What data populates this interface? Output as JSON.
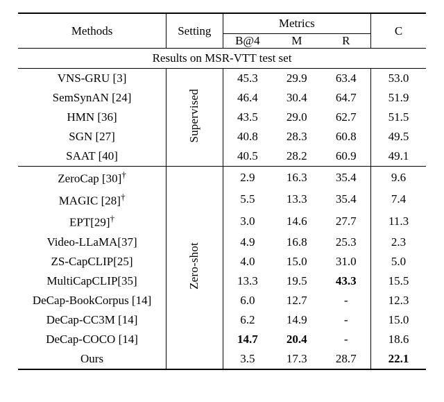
{
  "header": {
    "methods": "Methods",
    "setting": "Setting",
    "metrics_group": "Metrics",
    "m_b4": "B@4",
    "m_m": "M",
    "m_r": "R",
    "m_c": "C"
  },
  "section_title": "Results on MSR-VTT test set",
  "groups": [
    {
      "setting_label": "Supervised"
    },
    {
      "setting_label": "Zero-shot"
    }
  ],
  "rows_supervised": [
    {
      "method": "VNS-GRU [3]",
      "b4": "45.3",
      "m": "29.9",
      "r": "63.4",
      "c": "53.0"
    },
    {
      "method": "SemSynAN [24]",
      "b4": "46.4",
      "m": "30.4",
      "r": "64.7",
      "c": "51.9"
    },
    {
      "method": "HMN [36]",
      "b4": "43.5",
      "m": "29.0",
      "r": "62.7",
      "c": "51.5"
    },
    {
      "method": "SGN [27]",
      "b4": "40.8",
      "m": "28.3",
      "r": "60.8",
      "c": "49.5"
    },
    {
      "method": "SAAT [40]",
      "b4": "40.5",
      "m": "28.2",
      "r": "60.9",
      "c": "49.1"
    }
  ],
  "rows_zeroshot": [
    {
      "method": "ZeroCap [30]†",
      "b4": "2.9",
      "m": "16.3",
      "r": "35.4",
      "c": "9.6"
    },
    {
      "method": "MAGIC [28]†",
      "b4": "5.5",
      "m": "13.3",
      "r": "35.4",
      "c": "7.4"
    },
    {
      "method": "EPT[29]†",
      "b4": "3.0",
      "m": "14.6",
      "r": "27.7",
      "c": "11.3"
    },
    {
      "method": "Video-LLaMA[37]",
      "b4": "4.9",
      "m": "16.8",
      "r": "25.3",
      "c": "2.3"
    },
    {
      "method": "ZS-CapCLIP[25]",
      "b4": "4.0",
      "m": "15.0",
      "r": "31.0",
      "c": "5.0"
    },
    {
      "method": "MultiCapCLIP[35]",
      "b4": "13.3",
      "m": "19.5",
      "r": "43.3",
      "r_bold": true,
      "c": "15.5"
    },
    {
      "method": "DeCap-BookCorpus [14]",
      "b4": "6.0",
      "m": "12.7",
      "r": "-",
      "c": "12.3"
    },
    {
      "method": "DeCap-CC3M [14]",
      "b4": "6.2",
      "m": "14.9",
      "r": "-",
      "c": "15.0"
    },
    {
      "method": "DeCap-COCO [14]",
      "b4": "14.7",
      "b4_bold": true,
      "m": "20.4",
      "m_bold": true,
      "r": "-",
      "c": "18.6"
    },
    {
      "method": "Ours",
      "b4": "3.5",
      "m": "17.3",
      "r": "28.7",
      "c": "22.1",
      "c_bold": true
    }
  ],
  "chart_data": {
    "type": "table",
    "title": "Results on MSR-VTT test set",
    "columns": [
      "Methods",
      "Setting",
      "B@4",
      "M",
      "R",
      "C"
    ],
    "rows": [
      [
        "VNS-GRU [3]",
        "Supervised",
        45.3,
        29.9,
        63.4,
        53.0
      ],
      [
        "SemSynAN [24]",
        "Supervised",
        46.4,
        30.4,
        64.7,
        51.9
      ],
      [
        "HMN [36]",
        "Supervised",
        43.5,
        29.0,
        62.7,
        51.5
      ],
      [
        "SGN [27]",
        "Supervised",
        40.8,
        28.3,
        60.8,
        49.5
      ],
      [
        "SAAT [40]",
        "Supervised",
        40.5,
        28.2,
        60.9,
        49.1
      ],
      [
        "ZeroCap [30]†",
        "Zero-shot",
        2.9,
        16.3,
        35.4,
        9.6
      ],
      [
        "MAGIC [28]†",
        "Zero-shot",
        5.5,
        13.3,
        35.4,
        7.4
      ],
      [
        "EPT[29]†",
        "Zero-shot",
        3.0,
        14.6,
        27.7,
        11.3
      ],
      [
        "Video-LLaMA[37]",
        "Zero-shot",
        4.9,
        16.8,
        25.3,
        2.3
      ],
      [
        "ZS-CapCLIP[25]",
        "Zero-shot",
        4.0,
        15.0,
        31.0,
        5.0
      ],
      [
        "MultiCapCLIP[35]",
        "Zero-shot",
        13.3,
        19.5,
        43.3,
        15.5
      ],
      [
        "DeCap-BookCorpus [14]",
        "Zero-shot",
        6.0,
        12.7,
        null,
        12.3
      ],
      [
        "DeCap-CC3M [14]",
        "Zero-shot",
        6.2,
        14.9,
        null,
        15.0
      ],
      [
        "DeCap-COCO [14]",
        "Zero-shot",
        14.7,
        20.4,
        null,
        18.6
      ],
      [
        "Ours",
        "Zero-shot",
        3.5,
        17.3,
        28.7,
        22.1
      ]
    ],
    "bold_cells": [
      {
        "row": 10,
        "col": "R"
      },
      {
        "row": 13,
        "col": "B@4"
      },
      {
        "row": 13,
        "col": "M"
      },
      {
        "row": 14,
        "col": "C"
      }
    ]
  }
}
